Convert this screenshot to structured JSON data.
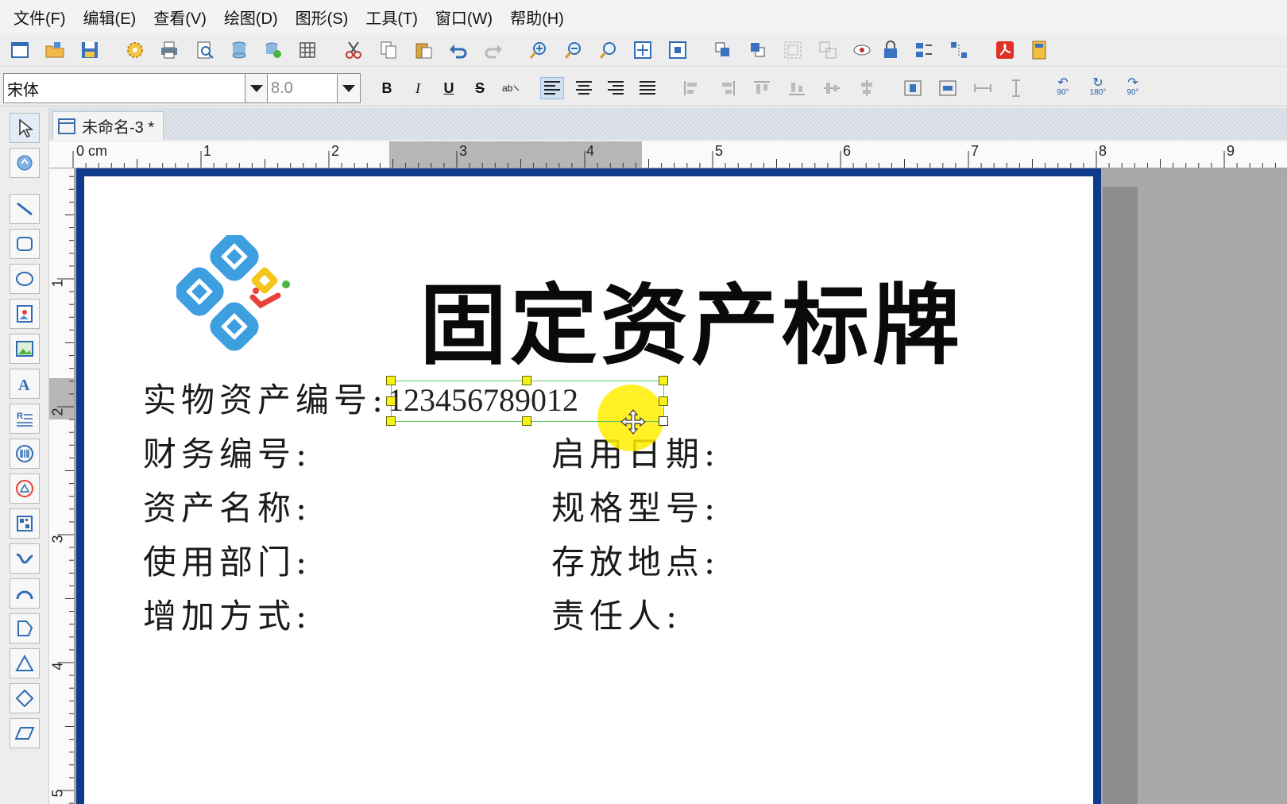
{
  "menu": [
    "文件(F)",
    "编辑(E)",
    "查看(V)",
    "绘图(D)",
    "图形(S)",
    "工具(T)",
    "窗口(W)",
    "帮助(H)"
  ],
  "toolbar": {
    "icons": [
      "new-icon",
      "open-icon",
      "save-icon",
      "settings-icon",
      "print-icon",
      "print-preview-icon",
      "database-icon",
      "database-connect-icon",
      "grid-icon",
      "cut-icon",
      "copy-icon",
      "paste-icon",
      "undo-icon",
      "redo-icon",
      "zoom-in-icon",
      "zoom-out-icon",
      "zoom-icon",
      "fit-page-icon",
      "actual-size-icon",
      "bring-forward-icon",
      "send-backward-icon",
      "group-icon",
      "ungroup-icon",
      "visibility-icon",
      "lock-icon",
      "align-icon",
      "distribute-icon",
      "pdf-icon",
      "calculator-icon"
    ]
  },
  "format": {
    "font_name": "宋体",
    "font_size": "8.0",
    "bold": "B",
    "italic": "I",
    "underline": "U",
    "strike": "S",
    "rotate_labels": [
      "90°",
      "180°",
      "90°"
    ]
  },
  "document": {
    "tab_title": "未命名-3 *"
  },
  "ruler": {
    "top_labels": [
      "0 cm",
      "1",
      "2",
      "3",
      "4",
      "5",
      "6",
      "7",
      "8",
      "9"
    ],
    "left_labels": [
      "1",
      "2",
      "3",
      "4",
      "5"
    ]
  },
  "label": {
    "title": "固定资产标牌",
    "fields_left": [
      "实物资产编号:",
      "财务编号:",
      "资产名称:",
      "使用部门:",
      "增加方式:"
    ],
    "fields_right": [
      "启用日期:",
      "规格型号:",
      "存放地点:",
      "责任人:"
    ],
    "asset_number": "123456789012"
  },
  "colors": {
    "page_border": "#0f3b8c",
    "selection": "#5cc85c",
    "handle": "#f6f11a",
    "cursor_highlight": "#ffee00",
    "logo_blue": "#3d9ee0",
    "logo_yellow": "#f5c518",
    "logo_red": "#e8413a",
    "logo_green": "#4bb443"
  }
}
